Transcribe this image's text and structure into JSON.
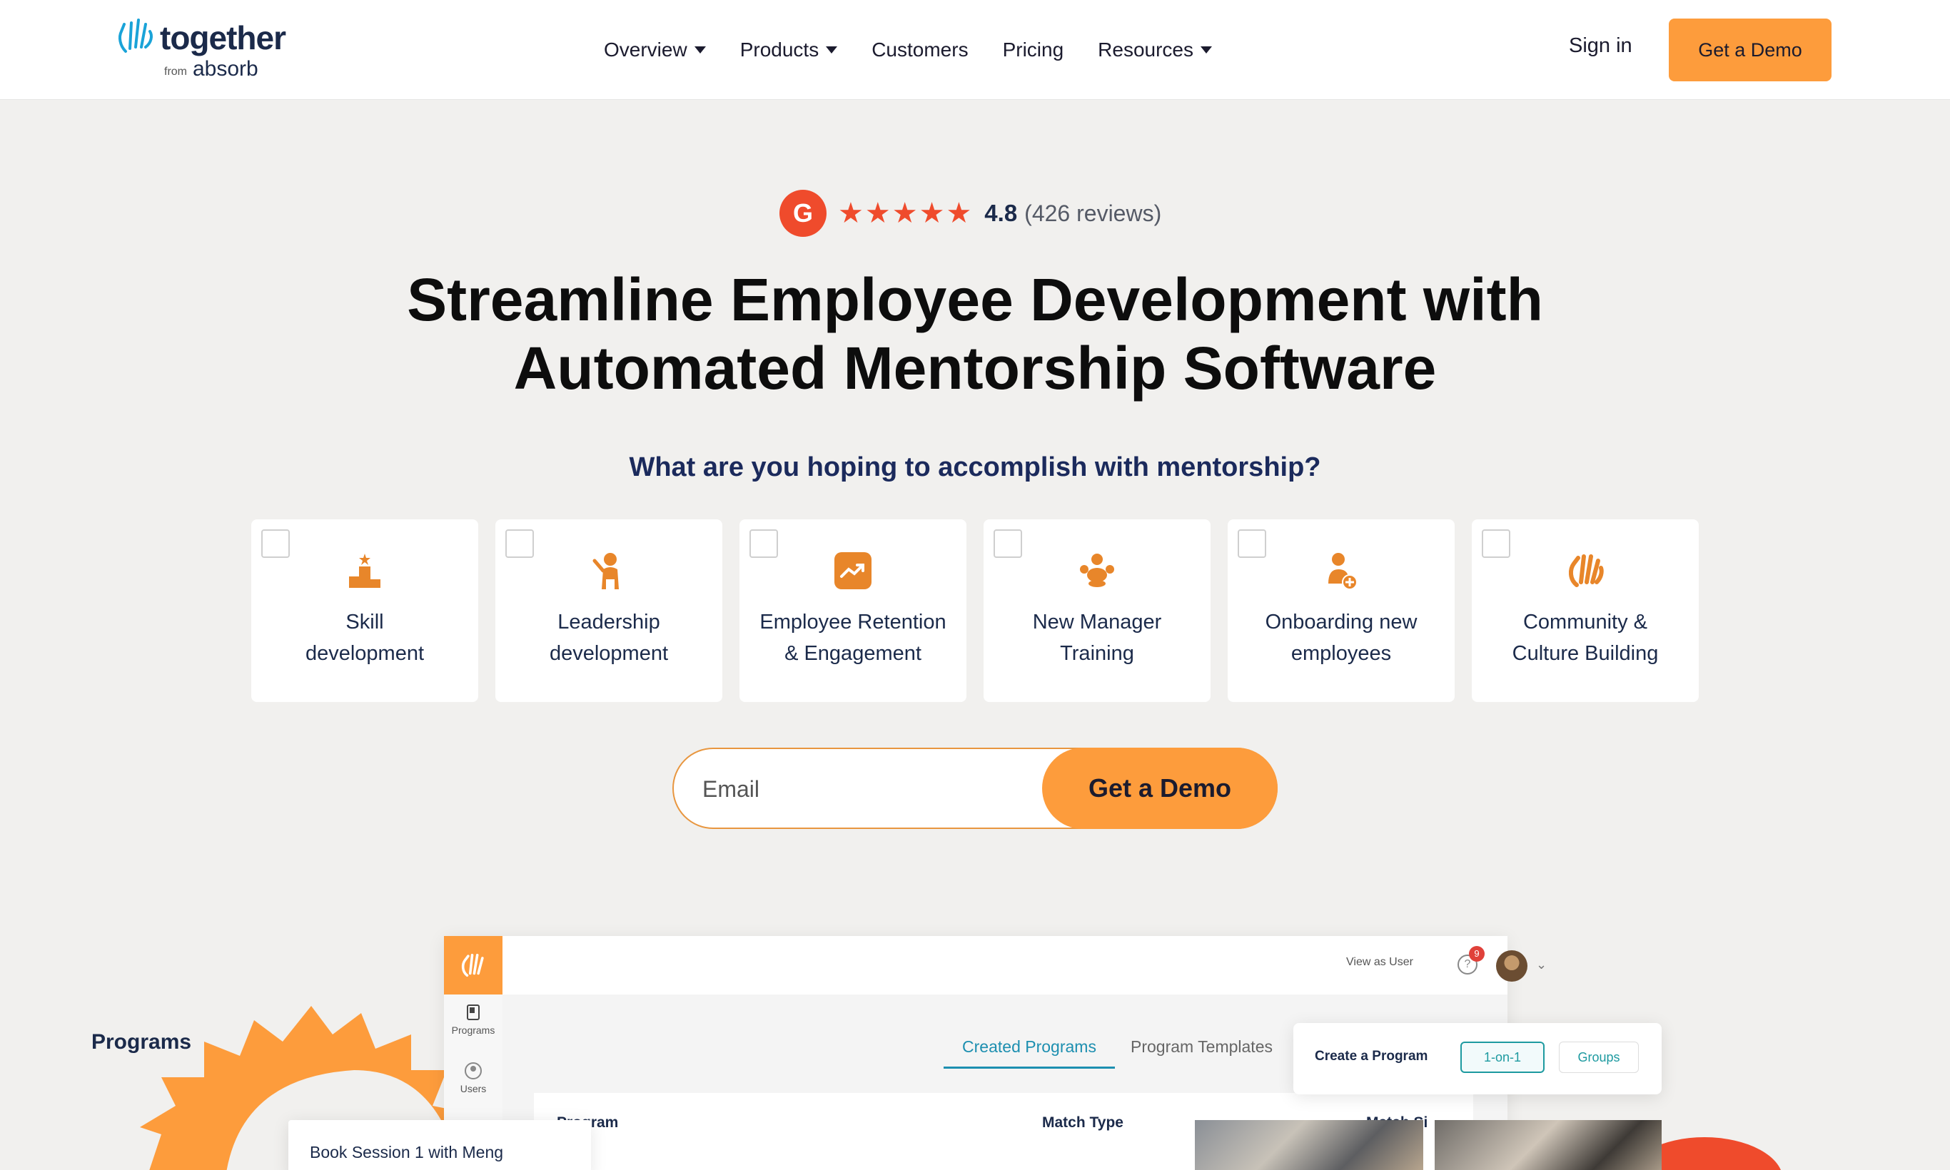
{
  "nav": {
    "logo_word": "together",
    "logo_from": "from",
    "logo_absorb": "absorb",
    "menu": [
      {
        "label": "Overview",
        "has_caret": true
      },
      {
        "label": "Products",
        "has_caret": true
      },
      {
        "label": "Customers",
        "has_caret": false
      },
      {
        "label": "Pricing",
        "has_caret": false
      },
      {
        "label": "Resources",
        "has_caret": true
      }
    ],
    "sign_in": "Sign in",
    "demo_button": "Get a Demo"
  },
  "rating": {
    "badge": "G",
    "stars": 5,
    "score": "4.8",
    "reviews": "(426 reviews)"
  },
  "hero": {
    "title_line1": "Streamline Employee Development with",
    "title_line2": "Automated Mentorship Software",
    "question": "What are you hoping to accomplish with mentorship?"
  },
  "goals": [
    {
      "line1": "Skill",
      "line2": "development",
      "icon": "podium-icon",
      "checked": false
    },
    {
      "line1": "Leadership",
      "line2": "development",
      "icon": "leader-icon",
      "checked": false
    },
    {
      "line1": "Employee Retention",
      "line2": "& Engagement",
      "icon": "trend-up-icon",
      "checked": false
    },
    {
      "line1": "New Manager",
      "line2": "Training",
      "icon": "team-icon",
      "checked": false
    },
    {
      "line1": "Onboarding new",
      "line2": "employees",
      "icon": "add-user-icon",
      "checked": false
    },
    {
      "line1": "Community &",
      "line2": "Culture Building",
      "icon": "waving-hand-icon",
      "checked": false
    }
  ],
  "form": {
    "email_placeholder": "Email",
    "demo_button": "Get a Demo"
  },
  "app_preview": {
    "sidebar": [
      {
        "label": "Programs",
        "icon": "book-icon"
      },
      {
        "label": "Users",
        "icon": "user-circle-icon"
      }
    ],
    "view_as_user": "View as User",
    "notification_count": "9",
    "page_title": "Programs",
    "tabs": {
      "created": "Created Programs",
      "templates": "Program Templates"
    },
    "table_headers": [
      "Program",
      "Match Type",
      "Match Si"
    ],
    "create_program": {
      "label": "Create a Program",
      "one_on_one": "1-on-1",
      "groups": "Groups"
    },
    "book_session": "Book Session 1 with Meng"
  },
  "colors": {
    "accent": "#fd9c3c",
    "g2_red": "#ef4b2c",
    "navy": "#1b2a4a",
    "teal": "#1d9aa0",
    "background": "#f1f0ee"
  }
}
